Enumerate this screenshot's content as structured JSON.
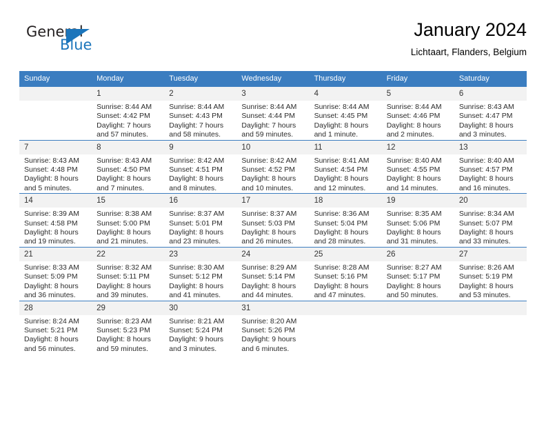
{
  "brand": {
    "word1": "General",
    "word2": "Blue",
    "logo_icon": "triangle-logo-icon",
    "color_blue": "#1b75bb",
    "color_dark": "#231f20"
  },
  "header": {
    "title": "January 2024",
    "location": "Lichtaart, Flanders, Belgium"
  },
  "theme": {
    "header_row_bg": "#3b7dc0",
    "daynum_bg": "#f2f2f2",
    "rule_color": "#3b7dc0"
  },
  "weekday_headers": [
    "Sunday",
    "Monday",
    "Tuesday",
    "Wednesday",
    "Thursday",
    "Friday",
    "Saturday"
  ],
  "weeks": [
    [
      {
        "day": "",
        "sunrise": "",
        "sunset": "",
        "daylight1": "",
        "daylight2": ""
      },
      {
        "day": "1",
        "sunrise": "Sunrise: 8:44 AM",
        "sunset": "Sunset: 4:42 PM",
        "daylight1": "Daylight: 7 hours",
        "daylight2": "and 57 minutes."
      },
      {
        "day": "2",
        "sunrise": "Sunrise: 8:44 AM",
        "sunset": "Sunset: 4:43 PM",
        "daylight1": "Daylight: 7 hours",
        "daylight2": "and 58 minutes."
      },
      {
        "day": "3",
        "sunrise": "Sunrise: 8:44 AM",
        "sunset": "Sunset: 4:44 PM",
        "daylight1": "Daylight: 7 hours",
        "daylight2": "and 59 minutes."
      },
      {
        "day": "4",
        "sunrise": "Sunrise: 8:44 AM",
        "sunset": "Sunset: 4:45 PM",
        "daylight1": "Daylight: 8 hours",
        "daylight2": "and 1 minute."
      },
      {
        "day": "5",
        "sunrise": "Sunrise: 8:44 AM",
        "sunset": "Sunset: 4:46 PM",
        "daylight1": "Daylight: 8 hours",
        "daylight2": "and 2 minutes."
      },
      {
        "day": "6",
        "sunrise": "Sunrise: 8:43 AM",
        "sunset": "Sunset: 4:47 PM",
        "daylight1": "Daylight: 8 hours",
        "daylight2": "and 3 minutes."
      }
    ],
    [
      {
        "day": "7",
        "sunrise": "Sunrise: 8:43 AM",
        "sunset": "Sunset: 4:48 PM",
        "daylight1": "Daylight: 8 hours",
        "daylight2": "and 5 minutes."
      },
      {
        "day": "8",
        "sunrise": "Sunrise: 8:43 AM",
        "sunset": "Sunset: 4:50 PM",
        "daylight1": "Daylight: 8 hours",
        "daylight2": "and 7 minutes."
      },
      {
        "day": "9",
        "sunrise": "Sunrise: 8:42 AM",
        "sunset": "Sunset: 4:51 PM",
        "daylight1": "Daylight: 8 hours",
        "daylight2": "and 8 minutes."
      },
      {
        "day": "10",
        "sunrise": "Sunrise: 8:42 AM",
        "sunset": "Sunset: 4:52 PM",
        "daylight1": "Daylight: 8 hours",
        "daylight2": "and 10 minutes."
      },
      {
        "day": "11",
        "sunrise": "Sunrise: 8:41 AM",
        "sunset": "Sunset: 4:54 PM",
        "daylight1": "Daylight: 8 hours",
        "daylight2": "and 12 minutes."
      },
      {
        "day": "12",
        "sunrise": "Sunrise: 8:40 AM",
        "sunset": "Sunset: 4:55 PM",
        "daylight1": "Daylight: 8 hours",
        "daylight2": "and 14 minutes."
      },
      {
        "day": "13",
        "sunrise": "Sunrise: 8:40 AM",
        "sunset": "Sunset: 4:57 PM",
        "daylight1": "Daylight: 8 hours",
        "daylight2": "and 16 minutes."
      }
    ],
    [
      {
        "day": "14",
        "sunrise": "Sunrise: 8:39 AM",
        "sunset": "Sunset: 4:58 PM",
        "daylight1": "Daylight: 8 hours",
        "daylight2": "and 19 minutes."
      },
      {
        "day": "15",
        "sunrise": "Sunrise: 8:38 AM",
        "sunset": "Sunset: 5:00 PM",
        "daylight1": "Daylight: 8 hours",
        "daylight2": "and 21 minutes."
      },
      {
        "day": "16",
        "sunrise": "Sunrise: 8:37 AM",
        "sunset": "Sunset: 5:01 PM",
        "daylight1": "Daylight: 8 hours",
        "daylight2": "and 23 minutes."
      },
      {
        "day": "17",
        "sunrise": "Sunrise: 8:37 AM",
        "sunset": "Sunset: 5:03 PM",
        "daylight1": "Daylight: 8 hours",
        "daylight2": "and 26 minutes."
      },
      {
        "day": "18",
        "sunrise": "Sunrise: 8:36 AM",
        "sunset": "Sunset: 5:04 PM",
        "daylight1": "Daylight: 8 hours",
        "daylight2": "and 28 minutes."
      },
      {
        "day": "19",
        "sunrise": "Sunrise: 8:35 AM",
        "sunset": "Sunset: 5:06 PM",
        "daylight1": "Daylight: 8 hours",
        "daylight2": "and 31 minutes."
      },
      {
        "day": "20",
        "sunrise": "Sunrise: 8:34 AM",
        "sunset": "Sunset: 5:07 PM",
        "daylight1": "Daylight: 8 hours",
        "daylight2": "and 33 minutes."
      }
    ],
    [
      {
        "day": "21",
        "sunrise": "Sunrise: 8:33 AM",
        "sunset": "Sunset: 5:09 PM",
        "daylight1": "Daylight: 8 hours",
        "daylight2": "and 36 minutes."
      },
      {
        "day": "22",
        "sunrise": "Sunrise: 8:32 AM",
        "sunset": "Sunset: 5:11 PM",
        "daylight1": "Daylight: 8 hours",
        "daylight2": "and 39 minutes."
      },
      {
        "day": "23",
        "sunrise": "Sunrise: 8:30 AM",
        "sunset": "Sunset: 5:12 PM",
        "daylight1": "Daylight: 8 hours",
        "daylight2": "and 41 minutes."
      },
      {
        "day": "24",
        "sunrise": "Sunrise: 8:29 AM",
        "sunset": "Sunset: 5:14 PM",
        "daylight1": "Daylight: 8 hours",
        "daylight2": "and 44 minutes."
      },
      {
        "day": "25",
        "sunrise": "Sunrise: 8:28 AM",
        "sunset": "Sunset: 5:16 PM",
        "daylight1": "Daylight: 8 hours",
        "daylight2": "and 47 minutes."
      },
      {
        "day": "26",
        "sunrise": "Sunrise: 8:27 AM",
        "sunset": "Sunset: 5:17 PM",
        "daylight1": "Daylight: 8 hours",
        "daylight2": "and 50 minutes."
      },
      {
        "day": "27",
        "sunrise": "Sunrise: 8:26 AM",
        "sunset": "Sunset: 5:19 PM",
        "daylight1": "Daylight: 8 hours",
        "daylight2": "and 53 minutes."
      }
    ],
    [
      {
        "day": "28",
        "sunrise": "Sunrise: 8:24 AM",
        "sunset": "Sunset: 5:21 PM",
        "daylight1": "Daylight: 8 hours",
        "daylight2": "and 56 minutes."
      },
      {
        "day": "29",
        "sunrise": "Sunrise: 8:23 AM",
        "sunset": "Sunset: 5:23 PM",
        "daylight1": "Daylight: 8 hours",
        "daylight2": "and 59 minutes."
      },
      {
        "day": "30",
        "sunrise": "Sunrise: 8:21 AM",
        "sunset": "Sunset: 5:24 PM",
        "daylight1": "Daylight: 9 hours",
        "daylight2": "and 3 minutes."
      },
      {
        "day": "31",
        "sunrise": "Sunrise: 8:20 AM",
        "sunset": "Sunset: 5:26 PM",
        "daylight1": "Daylight: 9 hours",
        "daylight2": "and 6 minutes."
      },
      {
        "day": "",
        "sunrise": "",
        "sunset": "",
        "daylight1": "",
        "daylight2": ""
      },
      {
        "day": "",
        "sunrise": "",
        "sunset": "",
        "daylight1": "",
        "daylight2": ""
      },
      {
        "day": "",
        "sunrise": "",
        "sunset": "",
        "daylight1": "",
        "daylight2": ""
      }
    ]
  ]
}
